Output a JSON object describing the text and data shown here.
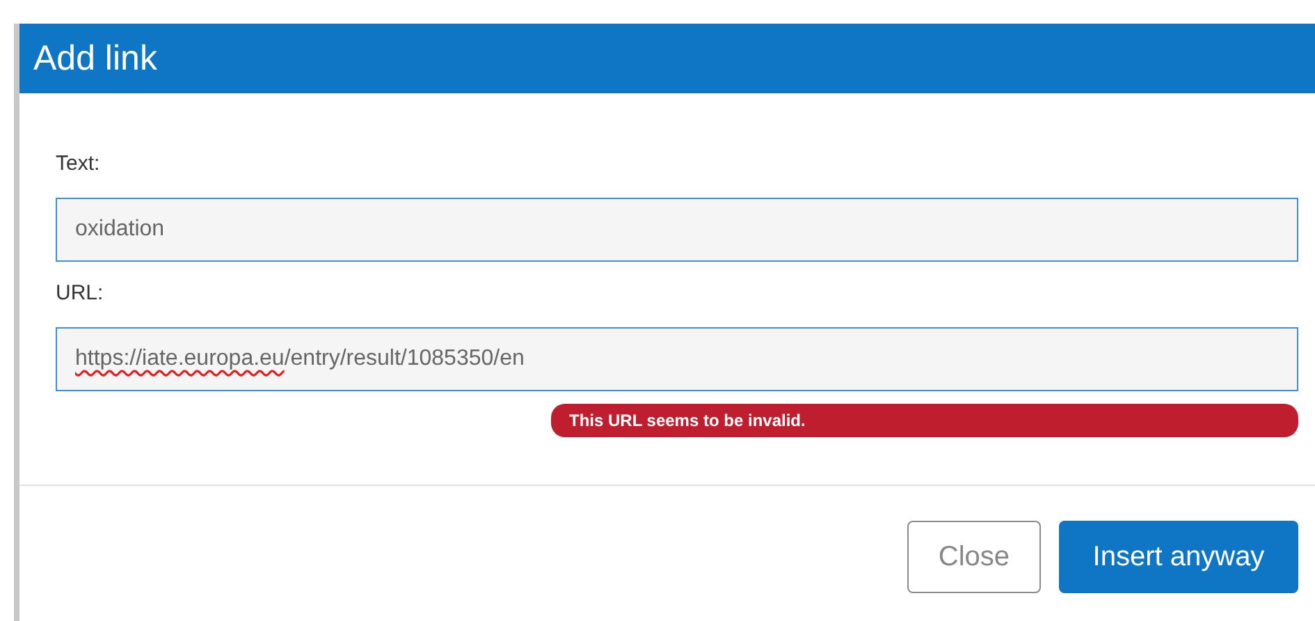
{
  "dialog": {
    "title": "Add link",
    "fields": [
      {
        "label": "Text:",
        "value": "oxidation"
      },
      {
        "label": "URL:",
        "value": "https://iate.europa.eu/entry/result/1085350/en",
        "spelling_marked": true,
        "error": "This URL seems to be invalid."
      }
    ],
    "buttons": [
      {
        "label": "Close",
        "kind": "secondary"
      },
      {
        "label": "Insert anyway",
        "kind": "primary"
      }
    ]
  }
}
